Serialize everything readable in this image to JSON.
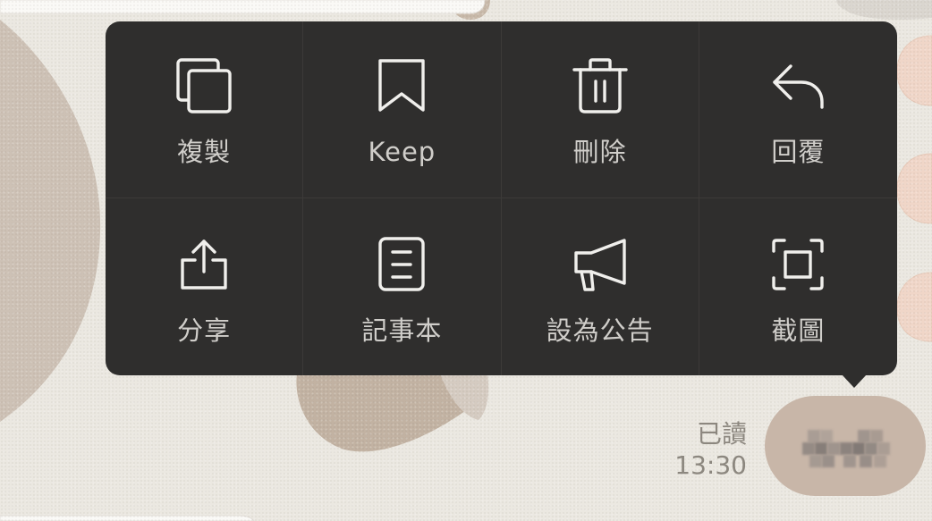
{
  "menu": {
    "items": [
      {
        "label": "複製",
        "icon": "copy-icon"
      },
      {
        "label": "Keep",
        "icon": "bookmark-icon"
      },
      {
        "label": "刪除",
        "icon": "trash-icon"
      },
      {
        "label": "回覆",
        "icon": "reply-icon"
      },
      {
        "label": "分享",
        "icon": "share-icon"
      },
      {
        "label": "記事本",
        "icon": "note-icon"
      },
      {
        "label": "設為公告",
        "icon": "megaphone-icon"
      },
      {
        "label": "截圖",
        "icon": "screenshot-icon"
      }
    ]
  },
  "message": {
    "read_status": "已讀",
    "time": "13:30"
  },
  "colors": {
    "menu_background": "#2f2e2d",
    "menu_text": "#d0ceca",
    "menu_icon": "#f0efec",
    "wallpaper": "#ebe8e1",
    "bubble": "#c8b6a8",
    "meta_text": "#8c877f"
  }
}
